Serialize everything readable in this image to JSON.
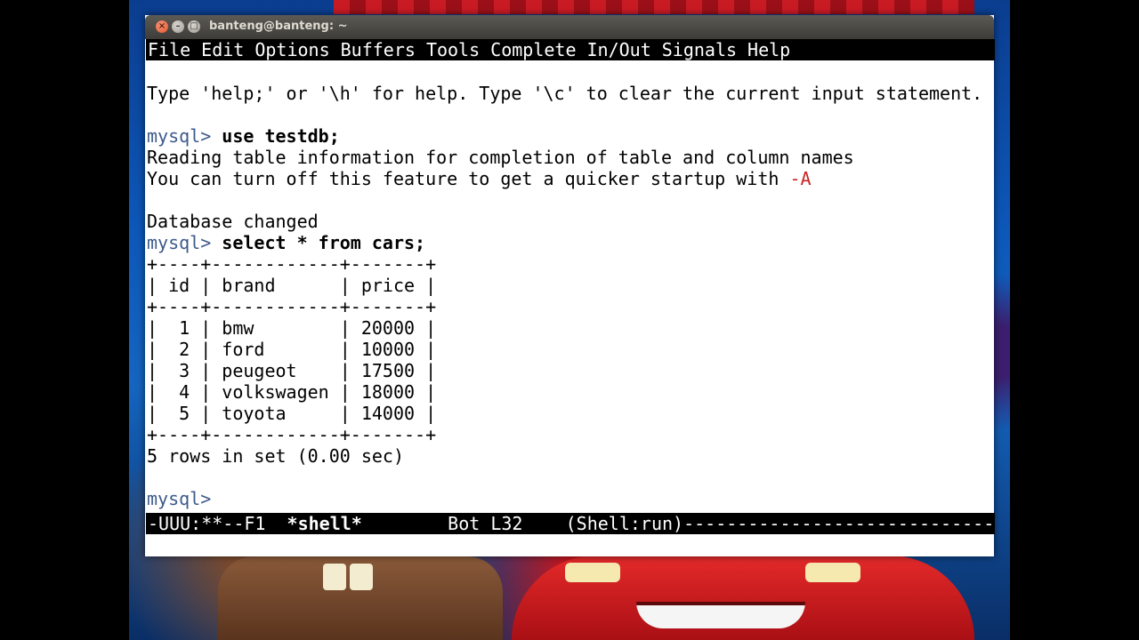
{
  "window": {
    "title": "banteng@banteng: ~",
    "buttons": {
      "close": "×",
      "min": "–",
      "max": "□"
    }
  },
  "menu": [
    "File",
    "Edit",
    "Options",
    "Buffers",
    "Tools",
    "Complete",
    "In/Out",
    "Signals",
    "Help"
  ],
  "terminal": {
    "intro": "Type 'help;' or '\\h' for help. Type '\\c' to clear the current input statement.",
    "prompt": "mysql>",
    "cmd1": "use testdb;",
    "reading1": "Reading table information for completion of table and column names",
    "reading2_text": "You can turn off this feature to get a quicker startup with ",
    "reading2_flag": "-A",
    "db_changed": "Database changed",
    "cmd2": "select * from cars;",
    "table_border": "+----+------------+-------+",
    "table_header": "| id | brand      | price |",
    "table_rows": [
      "|  1 | bmw        | 20000 |",
      "|  2 | ford       | 10000 |",
      "|  3 | peugeot    | 17500 |",
      "|  4 | volkswagen | 18000 |",
      "|  5 | toyota     | 14000 |"
    ],
    "result_summary": "5 rows in set (0.00 sec)",
    "final_prompt": "mysql>"
  },
  "modeline": {
    "status": "-UUU:**--F1  ",
    "buffer": "*shell*",
    "position": "        Bot L32    ",
    "mode": "(Shell:run)-----------------------------------------------------"
  },
  "colors": {
    "prompt": "#3d5a8c",
    "flag": "#c22222",
    "terminal_bg": "#ffffff",
    "bars_bg": "#000000"
  }
}
